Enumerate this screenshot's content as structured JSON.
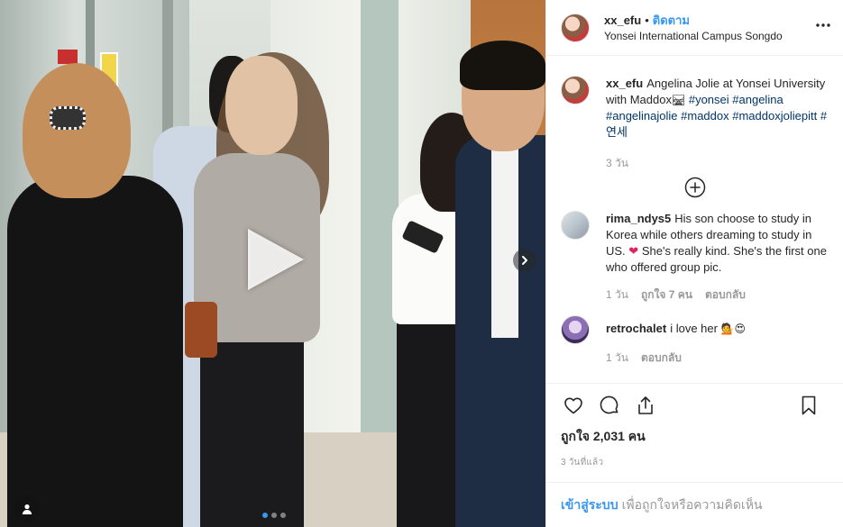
{
  "header": {
    "username": "xx_efu",
    "bullet": "•",
    "follow_label": "ติดตาม",
    "location": "Yonsei International Campus Songdo",
    "more_icon": "more-horizontal-icon"
  },
  "media": {
    "type": "video",
    "play_icon": "play-icon",
    "next_icon": "chevron-right-icon",
    "user_tag_icon": "user-tag-icon",
    "carousel_count": 3,
    "carousel_active_index": 0
  },
  "caption": {
    "username": "xx_efu",
    "text_before": "Angelina Jolie at Yonsei University with Maddox",
    "emoji": "🛤",
    "hashtags": [
      "#yonsei",
      "#angelina",
      "#angelinajolie",
      "#maddox",
      "#maddoxjoliepitt",
      "#연세"
    ],
    "time": "3 วัน"
  },
  "load_more_icon": "plus-circle-icon",
  "comments": [
    {
      "username": "rima_ndys5",
      "text_before": "His son choose to study in Korea while others dreaming to study in US.",
      "emoji": "❤",
      "text_after": "She's really kind. She's the first one who offered group pic.",
      "time": "1 วัน",
      "likes": "ถูกใจ 7 คน",
      "reply": "ตอบกลับ"
    },
    {
      "username": "retrochalet",
      "text_before": "i love her",
      "emoji": "💁😍",
      "text_after": "",
      "time": "1 วัน",
      "likes": "",
      "reply": "ตอบกลับ"
    }
  ],
  "actions": {
    "like_icon": "heart-icon",
    "comment_icon": "comment-icon",
    "share_icon": "share-icon",
    "save_icon": "bookmark-icon",
    "likes_text": "ถูกใจ 2,031 คน",
    "post_time": "3 วันที่แล้ว"
  },
  "login_bar": {
    "link": "เข้าสู่ระบบ",
    "text": "เพื่อถูกใจหรือความคิดเห็น"
  },
  "colors": {
    "link_blue": "#3897f0",
    "hashtag_blue": "#003569",
    "text": "#262626",
    "muted": "#999999",
    "border": "#efefef"
  }
}
